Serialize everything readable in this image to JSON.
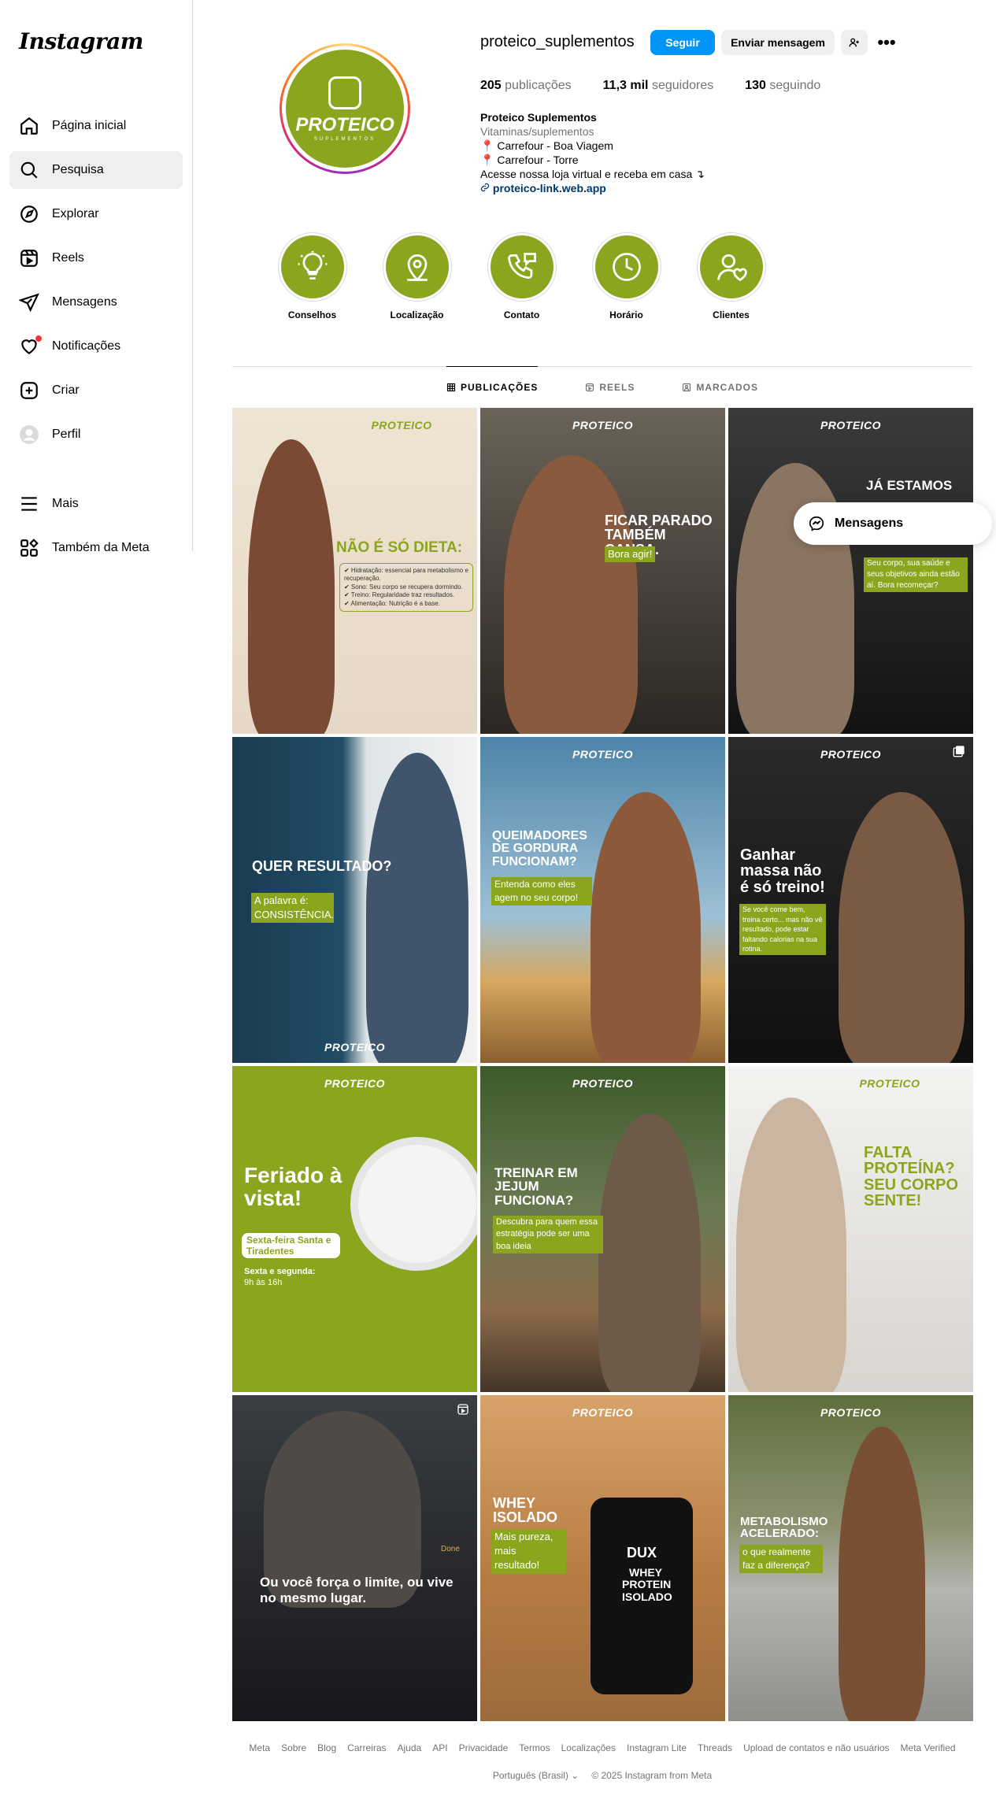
{
  "app": {
    "logo": "Instagram"
  },
  "sidebar": {
    "items": [
      {
        "label": "Página inicial",
        "icon": "home-icon"
      },
      {
        "label": "Pesquisa",
        "icon": "search-icon",
        "active": true
      },
      {
        "label": "Explorar",
        "icon": "compass-icon"
      },
      {
        "label": "Reels",
        "icon": "reels-icon"
      },
      {
        "label": "Mensagens",
        "icon": "paper-plane-icon"
      },
      {
        "label": "Notificações",
        "icon": "heart-icon"
      },
      {
        "label": "Criar",
        "icon": "plus-square-icon"
      },
      {
        "label": "Perfil",
        "icon": "profile-avatar-icon"
      }
    ],
    "more": {
      "label": "Mais",
      "icon": "hamburger-icon"
    },
    "meta": {
      "label": "Também da Meta",
      "icon": "grid-squares-icon"
    }
  },
  "profile": {
    "avatar": {
      "brand": "PROTEICO",
      "sub": "SUPLEMENTOS"
    },
    "username": "proteico_suplementos",
    "follow_label": "Seguir",
    "message_label": "Enviar mensagem",
    "more_label": "•••",
    "stats": {
      "posts_count": "205",
      "posts_label": "publicações",
      "followers_count": "11,3 mil",
      "followers_label": "seguidores",
      "following_count": "130",
      "following_label": "seguindo"
    },
    "bio": {
      "name": "Proteico Suplementos",
      "category": "Vitaminas/suplementos",
      "line1": "Carrefour - Boa Viagem",
      "line2": "Carrefour - Torre",
      "line3": "Acesse nossa loja virtual e receba em casa ↴",
      "link": "proteico-link.web.app"
    }
  },
  "highlights": [
    {
      "label": "Conselhos"
    },
    {
      "label": "Localização"
    },
    {
      "label": "Contato"
    },
    {
      "label": "Horário"
    },
    {
      "label": "Clientes"
    }
  ],
  "tabs": [
    {
      "label": "PUBLICAÇÕES",
      "active": true
    },
    {
      "label": "REELS"
    },
    {
      "label": "MARCADOS"
    }
  ],
  "posts": {
    "brand": "PROTEICO",
    "p1": {
      "headline": "NÃO É SÓ DIETA:",
      "items": [
        "✔ Hidratação: essencial para metabolismo e recuperação.",
        "✔ Sono: Seu corpo se recupera dormindo.",
        "✔ Treino: Regularidade traz resultados.",
        "✔ Alimentação: Nutrição é a base."
      ]
    },
    "p2": {
      "headline": "FICAR PARADO TAMBÉM CANSA.",
      "sub": "Bora agir!"
    },
    "p3": {
      "headline": "JÁ ESTAMOS",
      "sub": "Seu corpo, sua saúde e seus objetivos ainda estão aí. Bora recomeçar?"
    },
    "p4": {
      "headline": "QUER RESULTADO?",
      "sub": "A palavra é: CONSISTÊNCIA."
    },
    "p5": {
      "headline": "QUEIMADORES DE GORDURA FUNCIONAM?",
      "sub": "Entenda como eles agem no seu corpo!"
    },
    "p6": {
      "headline": "Ganhar massa não é só treino!",
      "sub": "Se você come bem, treina certo... mas não vê resultado, pode estar faltando calorias na sua rotina."
    },
    "p7": {
      "headline": "Feriado à vista!",
      "sub": "Sexta-feira Santa e Tiradentes",
      "note1": "Sexta e segunda:",
      "note2": "9h às 16h"
    },
    "p8": {
      "headline": "TREINAR EM JEJUM FUNCIONA?",
      "sub": "Descubra para quem essa estratégia pode ser uma boa ideia"
    },
    "p9": {
      "headline": "FALTA PROTEÍNA? SEU CORPO SENTE!"
    },
    "p10": {
      "headline": "Ou você força o limite, ou vive no mesmo lugar.",
      "done": "Done"
    },
    "p11": {
      "headline": "WHEY ISOLADO",
      "sub": "Mais pureza, mais resultado!",
      "product_brand": "DUX",
      "product_name": "WHEY PROTEIN ISOLADO"
    },
    "p12": {
      "headline": "METABOLISMO ACELERADO:",
      "sub": "o que realmente faz a diferença?"
    }
  },
  "messages_pill": {
    "label": "Mensagens"
  },
  "footer": {
    "links": [
      "Meta",
      "Sobre",
      "Blog",
      "Carreiras",
      "Ajuda",
      "API",
      "Privacidade",
      "Termos",
      "Localizações",
      "Instagram Lite",
      "Threads",
      "Upload de contatos e não usuários",
      "Meta Verified"
    ],
    "language": "Português (Brasil) ⌄",
    "copyright": "© 2025 Instagram from Meta"
  },
  "colors": {
    "brand_green": "#8ba51f",
    "follow_blue": "#0095f6",
    "notification_red": "#ff3040"
  }
}
